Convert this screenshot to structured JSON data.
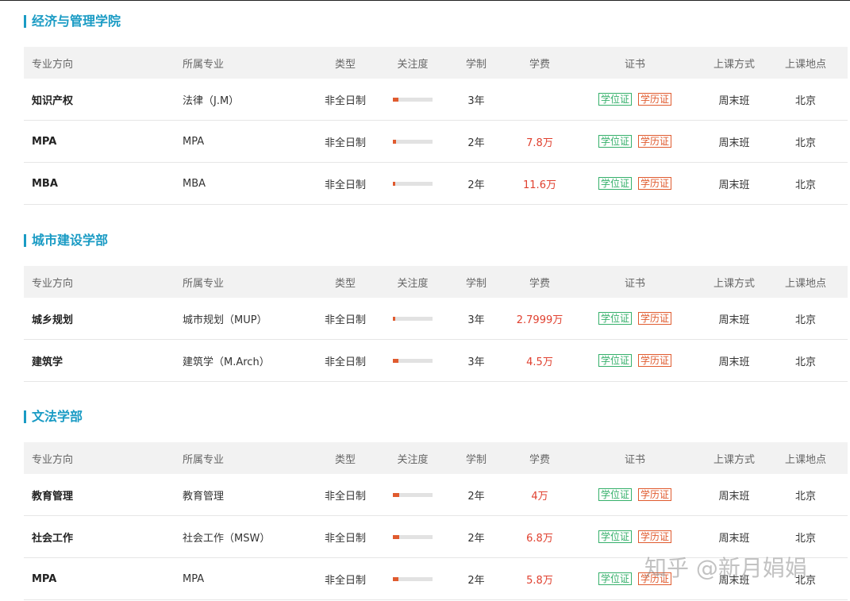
{
  "headers": {
    "direction": "专业方向",
    "major": "所属专业",
    "type": "类型",
    "attention": "关注度",
    "length": "学制",
    "fee": "学费",
    "certificate": "证书",
    "mode": "上课方式",
    "location": "上课地点"
  },
  "badges": {
    "degree": "学位证",
    "education": "学历证"
  },
  "sections": [
    {
      "title": "经济与管理学院",
      "rows": [
        {
          "direction": "知识产权",
          "major": "法律（J.M）",
          "type": "非全日制",
          "attention": 0.14,
          "length": "3年",
          "fee": "",
          "mode": "周末班",
          "location": "北京"
        },
        {
          "direction": "MPA",
          "major": "MPA",
          "type": "非全日制",
          "attention": 0.08,
          "length": "2年",
          "fee": "7.8万",
          "mode": "周末班",
          "location": "北京"
        },
        {
          "direction": "MBA",
          "major": "MBA",
          "type": "非全日制",
          "attention": 0.05,
          "length": "2年",
          "fee": "11.6万",
          "mode": "周末班",
          "location": "北京"
        }
      ]
    },
    {
      "title": "城市建设学部",
      "rows": [
        {
          "direction": "城乡规划",
          "major": "城市规划（MUP）",
          "type": "非全日制",
          "attention": 0.06,
          "length": "3年",
          "fee": "2.7999万",
          "mode": "周末班",
          "location": "北京"
        },
        {
          "direction": "建筑学",
          "major": "建筑学（M.Arch）",
          "type": "非全日制",
          "attention": 0.14,
          "length": "3年",
          "fee": "4.5万",
          "mode": "周末班",
          "location": "北京"
        }
      ]
    },
    {
      "title": "文法学部",
      "rows": [
        {
          "direction": "教育管理",
          "major": "教育管理",
          "type": "非全日制",
          "attention": 0.16,
          "length": "2年",
          "fee": "4万",
          "mode": "周末班",
          "location": "北京"
        },
        {
          "direction": "社会工作",
          "major": "社会工作（MSW）",
          "type": "非全日制",
          "attention": 0.16,
          "length": "2年",
          "fee": "6.8万",
          "mode": "周末班",
          "location": "北京"
        },
        {
          "direction": "MPA",
          "major": "MPA",
          "type": "非全日制",
          "attention": 0.14,
          "length": "2年",
          "fee": "5.8万",
          "mode": "周末班",
          "location": "北京"
        }
      ]
    }
  ],
  "watermark": "知乎 @新月娟娟",
  "colors": {
    "accent": "#1a9bc4",
    "fee": "#e0402f",
    "degree_badge": "#36b06b",
    "education_badge": "#e05b2f"
  }
}
